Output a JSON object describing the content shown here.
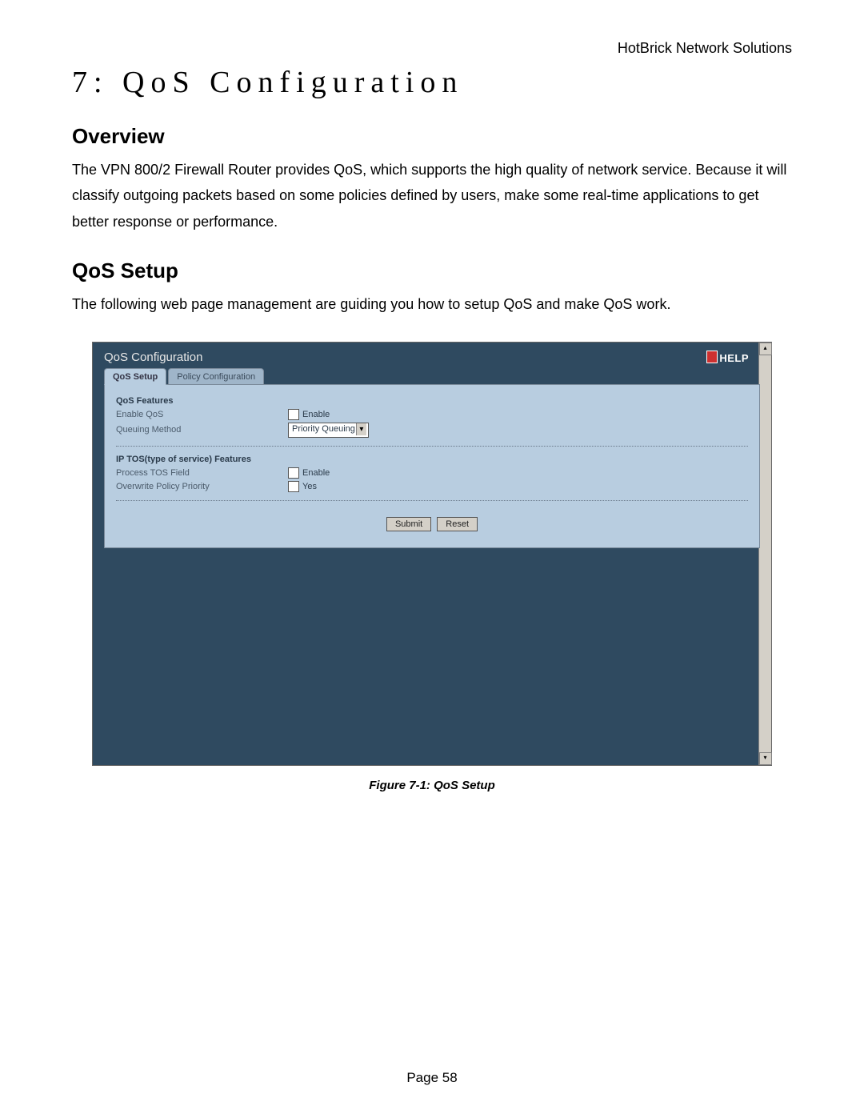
{
  "doc": {
    "company": "HotBrick Network Solutions",
    "chapter_title": "7: QoS Configuration",
    "section_overview_title": "Overview",
    "overview_body": "The VPN 800/2 Firewall Router provides QoS, which supports the high quality of network service. Because it will classify outgoing packets based on some policies defined by users, make some real-time applications to get better response or performance.",
    "section_setup_title": "QoS Setup",
    "setup_body": "The following web page management are guiding you how to setup QoS and make QoS work.",
    "figure_caption": "Figure 7-1: QoS Setup",
    "page_number": "Page 58"
  },
  "app": {
    "panel_title": "QoS Configuration",
    "help_label": "HELP",
    "tabs": {
      "active": "QoS Setup",
      "inactive": "Policy Configuration"
    },
    "section1_title": "QoS Features",
    "row_enable_qos_label": "Enable QoS",
    "row_enable_qos_cb_label": "Enable",
    "row_queuing_label": "Queuing Method",
    "queuing_select_value": "Priority Queuing",
    "section2_title": "IP TOS(type of service) Features",
    "row_process_tos_label": "Process TOS Field",
    "row_process_tos_cb_label": "Enable",
    "row_overwrite_label": "Overwrite Policy Priority",
    "row_overwrite_cb_label": "Yes",
    "btn_submit": "Submit",
    "btn_reset": "Reset"
  }
}
